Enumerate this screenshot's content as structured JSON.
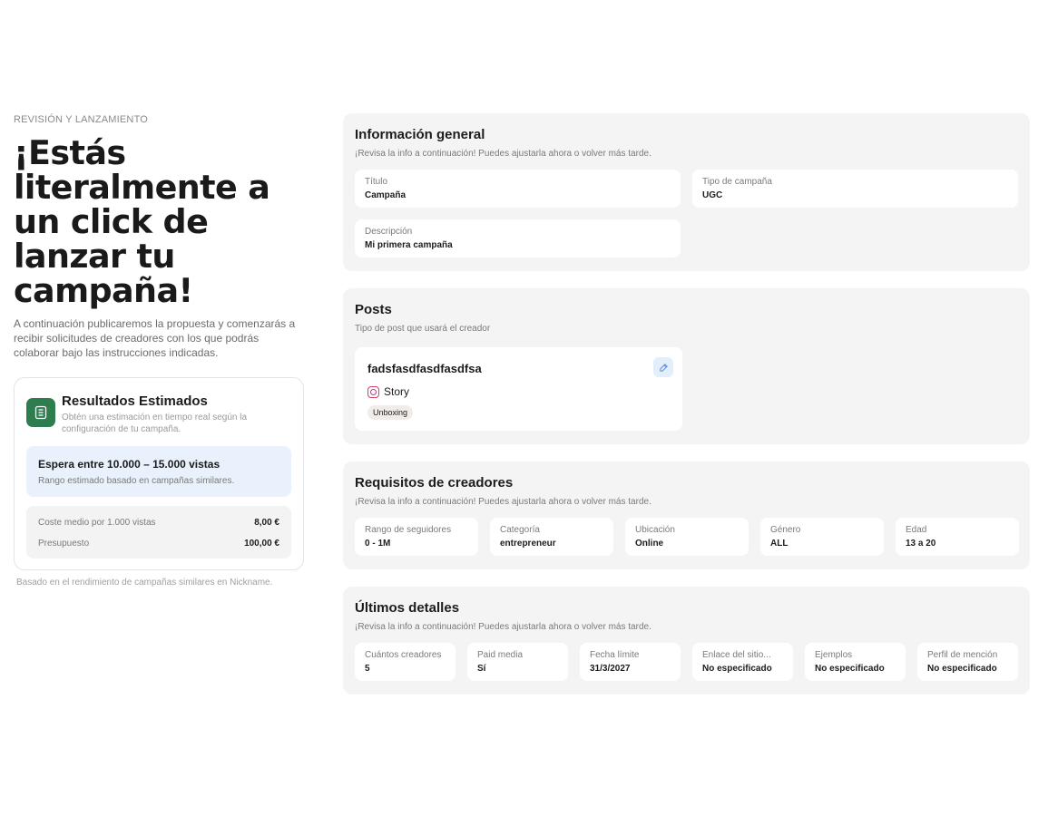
{
  "left": {
    "eyebrow": "REVISIÓN Y LANZAMIENTO",
    "headline": "¡Estás literalmente a un click de lanzar tu campaña!",
    "intro": "A continuación publicaremos la propuesta y comenzarás a recibir solicitudes de creadores con los que podrás colaborar bajo las instrucciones indicadas.",
    "estimate": {
      "title": "Resultados Estimados",
      "subtitle": "Obtén una estimación en tiempo real según la configuración de tu campaña.",
      "range_title": "Espera entre 10.000 – 15.000 vistas",
      "range_sub": "Rango estimado basado en campañas similares.",
      "costs": [
        {
          "label": "Coste medio por 1.000 vistas",
          "value": "8,00 €"
        },
        {
          "label": "Presupuesto",
          "value": "100,00 €"
        }
      ]
    },
    "footnote": "Basado en el rendimiento de campañas similares en Nickname."
  },
  "general": {
    "title": "Información general",
    "subtitle": "¡Revisa la info a continuación! Puedes ajustarla ahora o volver más tarde.",
    "fields": [
      {
        "label": "Título",
        "value": "Campaña"
      },
      {
        "label": "Tipo de campaña",
        "value": "UGC"
      },
      {
        "label": "Descripción",
        "value": "Mi primera campaña"
      }
    ]
  },
  "posts": {
    "title": "Posts",
    "subtitle": "Tipo de post que usará el creador",
    "post": {
      "name": "fadsfasdfasdfasdfsa",
      "type": "Story",
      "tag": "Unboxing",
      "icon": "instagram-icon"
    }
  },
  "requirements": {
    "title": "Requisitos de creadores",
    "subtitle": "¡Revisa la info a continuación! Puedes ajustarla ahora o volver más tarde.",
    "fields": [
      {
        "label": "Rango de seguidores",
        "value": "0 - 1M"
      },
      {
        "label": "Categoría",
        "value": "entrepreneur"
      },
      {
        "label": "Ubicación",
        "value": "Online"
      },
      {
        "label": "Género",
        "value": "ALL"
      },
      {
        "label": "Edad",
        "value": "13 a 20"
      }
    ]
  },
  "details": {
    "title": "Últimos detalles",
    "subtitle": "¡Revisa la info a continuación! Puedes ajustarla ahora o volver más tarde.",
    "fields": [
      {
        "label": "Cuántos creadores",
        "value": "5"
      },
      {
        "label": "Paid media",
        "value": "Sí"
      },
      {
        "label": "Fecha límite",
        "value": "31/3/2027"
      },
      {
        "label": "Enlace del sitio...",
        "value": "No especificado"
      },
      {
        "label": "Ejemplos",
        "value": "No especificado"
      },
      {
        "label": "Perfil de mención",
        "value": "No especificado"
      }
    ]
  },
  "colors": {
    "accent_green": "#2e7d4f",
    "range_bg": "#e8f1fc",
    "panel_bg": "#f4f4f4"
  }
}
